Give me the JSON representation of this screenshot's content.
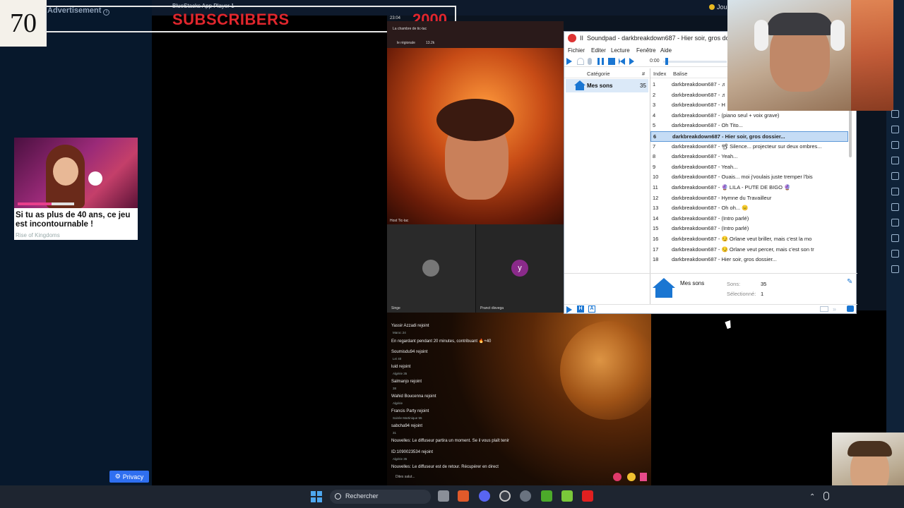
{
  "overlay": {
    "counter": "70",
    "subscribers_label": "SUBSCRIBERS",
    "subscribers_target": "2000"
  },
  "ad": {
    "label": "Advertisement",
    "title": "Si tu as plus de 40 ans, ce jeu est incontournable !",
    "source": "Rise of Kingdoms",
    "privacy": "Privacy"
  },
  "top": {
    "bluestacks": "BlueStacks App Player 1",
    "time": "23:04",
    "right_label": "Jou"
  },
  "stream": {
    "room_name": "La chambre de tic-tac",
    "region": "le régionale",
    "viewers": "13.2k",
    "host_label": "Host Tic-tac",
    "guest_left": "Singe",
    "guest_right": "Pranct disvega",
    "guest_right_initial": "y",
    "chat": [
      {
        "text": "Yassir Azzadi rejoint",
        "sub": "Maroc 24"
      },
      {
        "text": "En regardant pendant 20 minutes, contribuant 🔥+40",
        "sub": ""
      },
      {
        "text": "Soumisdu94 rejoint",
        "sub": "Lei 40"
      },
      {
        "text": "luid rejoint",
        "sub": "Algérie 35"
      },
      {
        "text": "Salmanjo rejoint",
        "sub": "38"
      },
      {
        "text": "Wahid Boucenna rejoint",
        "sub": "Algérie"
      },
      {
        "text": "Francis Party rejoint",
        "sub": "Soirée Martinique 55"
      },
      {
        "text": "sabcha94 rejoint",
        "sub": "31"
      },
      {
        "text": "Nouvelles: Le diffuseur partira un moment. Se il vous plaît tenir",
        "sub": ""
      },
      {
        "text": "ID:1090023534 rejoint",
        "sub": "Algérie 35"
      },
      {
        "text": "Nouvelles: Le diffuseur est de retour. Récupérer en direct",
        "sub": ""
      }
    ],
    "chat_placeholder": "Dites salut..."
  },
  "soundpad": {
    "title": "Soundpad - darkbreakdown687 - Hier soir, gros dossier...",
    "title_prefix": "II",
    "menu": [
      "Fichier",
      "Editer",
      "Lecture",
      "Fenêtre",
      "Aide"
    ],
    "time": "0:00",
    "cat_header": "Catégorie",
    "cat_count_header": "#",
    "categories": [
      {
        "name": "Mes sons",
        "count": "35"
      }
    ],
    "list_headers": {
      "index": "Index",
      "tag": "Balise"
    },
    "rows": [
      {
        "idx": "1",
        "text": "darkbreakdown687 - ♬"
      },
      {
        "idx": "2",
        "text": "darkbreakdown687 - ♬"
      },
      {
        "idx": "3",
        "text": "darkbreakdown687 - H"
      },
      {
        "idx": "4",
        "text": "darkbreakdown687 - (piano seul + voix grave)"
      },
      {
        "idx": "5",
        "text": "darkbreakdown687 - Oh Tito..."
      },
      {
        "idx": "6",
        "text": "darkbreakdown687 - Hier soir, gros dossier..."
      },
      {
        "idx": "7",
        "text": "darkbreakdown687 - 📽 Silence... projecteur sur deux ombres..."
      },
      {
        "idx": "8",
        "text": "darkbreakdown687 - Yeah..."
      },
      {
        "idx": "9",
        "text": "darkbreakdown687 - Yeah..."
      },
      {
        "idx": "10",
        "text": "darkbreakdown687 - Ouais... moi j'voulais juste tremper l'bis"
      },
      {
        "idx": "11",
        "text": "darkbreakdown687 - 🔮 LILA - PUTE DE BIGO 🔮"
      },
      {
        "idx": "12",
        "text": "darkbreakdown687 - Hymne du Travailleur"
      },
      {
        "idx": "13",
        "text": "darkbreakdown687 - Oh oh... 😐"
      },
      {
        "idx": "14",
        "text": "darkbreakdown687 - (Intro parlé)"
      },
      {
        "idx": "15",
        "text": "darkbreakdown687 - (Intro parlé)"
      },
      {
        "idx": "16",
        "text": "darkbreakdown687 - 😏 Orlane veut briller, mais c'est la mo"
      },
      {
        "idx": "17",
        "text": "darkbreakdown687 - 😏 Orlane veut percer, mais c'est son tr"
      },
      {
        "idx": "18",
        "text": "darkbreakdown687 - Hier soir, gros dossier..."
      }
    ],
    "selected_row": 5,
    "footer": {
      "name": "Mes sons",
      "sons_label": "Sons:",
      "sons_value": "35",
      "sel_label": "Sélectionné:",
      "sel_value": "1"
    },
    "accent": "#1a76d2"
  },
  "taskbar": {
    "search_placeholder": "Rechercher",
    "apps": [
      "file-explorer-icon",
      "brave-icon",
      "discord-icon",
      "chrome-icon",
      "settings-icon",
      "minecraft-icon",
      "bluestacks-icon",
      "youtube-icon"
    ]
  }
}
